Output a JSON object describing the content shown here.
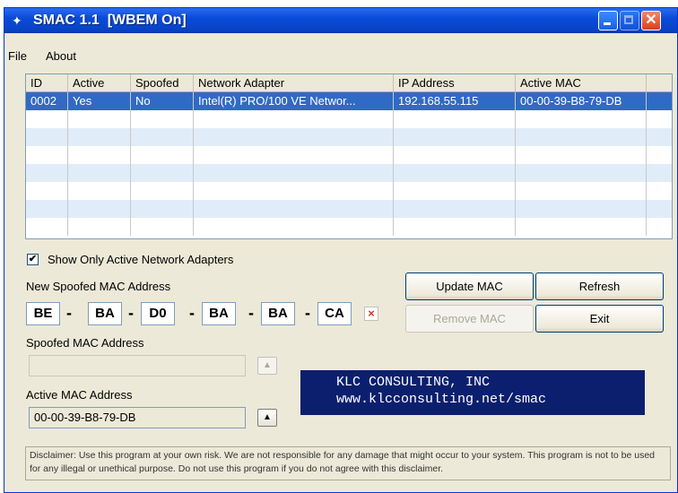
{
  "window": {
    "title": "SMAC 1.1  [WBEM On]"
  },
  "menu": [
    "File",
    "About"
  ],
  "table": {
    "columns": [
      "ID",
      "Active",
      "Spoofed",
      "Network Adapter",
      "IP Address",
      "Active MAC"
    ],
    "rows": [
      [
        "0002",
        "Yes",
        "No",
        "Intel(R) PRO/100 VE Networ...",
        "192.168.55.115",
        "00-00-39-B8-79-DB"
      ]
    ]
  },
  "options": {
    "show_active_label": "Show Only Active Network Adapters",
    "show_active_checked": true
  },
  "new_mac": {
    "label": "New Spoofed MAC Address",
    "octets": [
      "BE",
      "BA",
      "D0",
      "BA",
      "BA",
      "CA"
    ],
    "separator": "-",
    "clear_glyph": "×"
  },
  "buttons": {
    "update": "Update MAC",
    "refresh": "Refresh",
    "remove": "Remove MAC",
    "exit": "Exit"
  },
  "spoofed_mac": {
    "label": "Spoofed MAC Address",
    "value": ""
  },
  "active_mac": {
    "label": "Active MAC Address",
    "value": "00-00-39-B8-79-DB"
  },
  "banner": {
    "line1": "KLC CONSULTING, INC",
    "line2": "www.klcconsulting.net/smac"
  },
  "disclaimer": "Disclaimer: Use this program at your own risk.  We are not responsible for any damage that might occur to your system.  This program is not to be used for any illegal or unethical purpose.  Do not use this program if you do not agree with this disclaimer.",
  "icons": {
    "app": "network-card-icon",
    "minimize": "minimize-icon",
    "maximize": "maximize-icon",
    "close": "close-icon",
    "check": "checkmark-icon",
    "clear": "clear-x-icon",
    "up": "arrow-up-icon"
  },
  "colors": {
    "titlebar": "#0a4ad8",
    "selection": "#316ac5",
    "banner": "#0b1f6e",
    "clear_x": "#e03020"
  }
}
